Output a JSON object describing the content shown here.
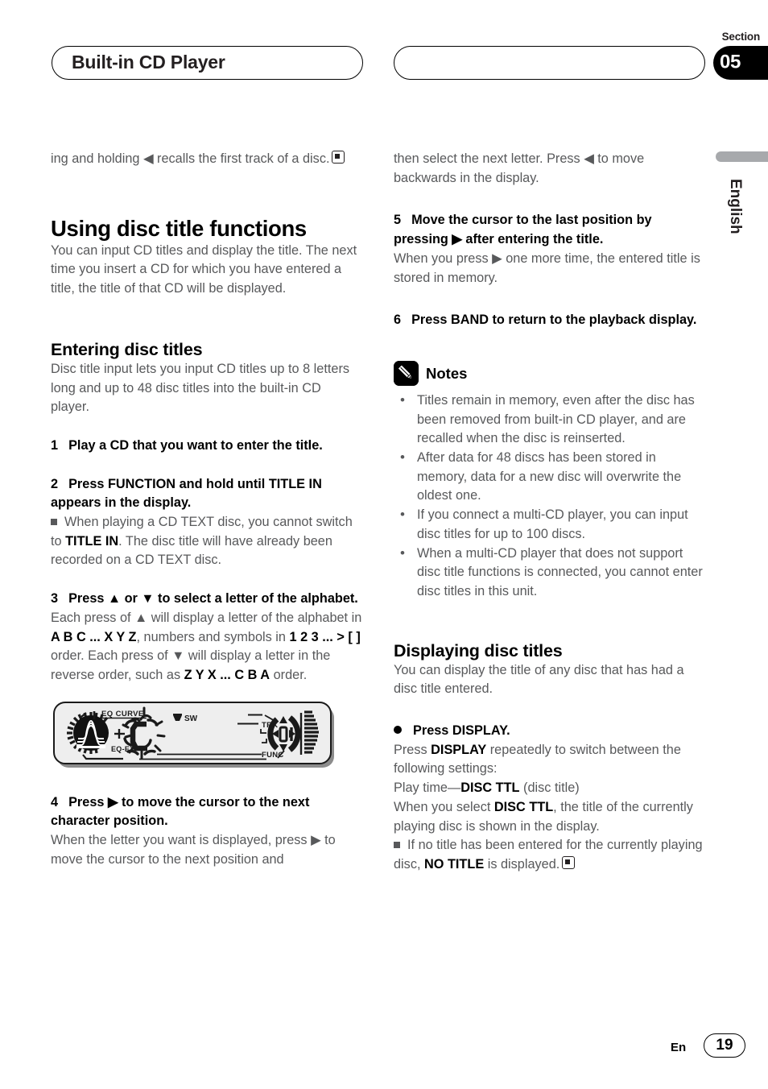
{
  "header": {
    "title": "Built-in CD Player",
    "section_label": "Section",
    "section_number": "05",
    "right_pill_text": ""
  },
  "side_tab": {
    "language": "English"
  },
  "footer": {
    "lang_code": "En",
    "page_number": "19"
  },
  "colors": {
    "body_text": "#58595b",
    "heading": "#000000",
    "tab_gray": "#a7a9ac",
    "badge_black": "#000000"
  },
  "left_column": {
    "continued_paragraph": {
      "part1": "ing and holding ",
      "arrow": "◀",
      "part2": " recalls the first track of a disc.",
      "end_marker": "end-of-section-marker"
    },
    "heading": "Using disc title functions",
    "intro": "You can input CD titles and display the title. The next time you insert a CD for which you have entered a title, the title of that CD will be displayed.",
    "subheading": "Entering disc titles",
    "sub_intro": "Disc title input lets you input CD titles up to 8 letters long and up to 48 disc titles into the built-in CD player.",
    "steps": [
      {
        "num": "1",
        "text": "Play a CD that you want to enter the title."
      },
      {
        "num": "2",
        "text": "Press FUNCTION and hold until TITLE IN appears in the display."
      },
      {
        "num": "3",
        "text": "Press ▲ or ▼ to select a letter of the alphabet."
      },
      {
        "num": "4",
        "text": "Press ▶ to move the cursor to the next character position."
      }
    ],
    "note_after_step2": {
      "a": "When playing a CD TEXT disc, you cannot switch to ",
      "b": "TITLE IN",
      "c": ". The disc title will have already been recorded on a CD TEXT disc."
    },
    "step3_body": {
      "a": "Each press of ▲ will display a letter of the alphabet in ",
      "b": "A B C ... X Y Z",
      "c": ", numbers and symbols in ",
      "d": "1 2 3 ... > [ ]",
      "e": " order. Each press of ▼ will display a letter in the reverse order, such as ",
      "f": "Z Y X ... C B A",
      "g": " order."
    },
    "step4_body": "When the letter you want is displayed, press ▶ to move the cursor to the next position and",
    "display_figure": {
      "name": "car-stereo-lcd-display",
      "labels": [
        "EQ CURVE",
        "EQ-EX",
        "SW",
        "TRK",
        "FUNC"
      ],
      "digit": "01",
      "character": "C"
    }
  },
  "right_column": {
    "continued_paragraph": "then select the next letter. Press ◀ to move backwards in the display.",
    "steps": [
      {
        "num": "5",
        "text": "Move the cursor to the last position by pressing ▶ after entering the title."
      },
      {
        "num": "6",
        "text": "Press BAND to return to the playback display."
      }
    ],
    "step5_body": "When you press ▶ one more time, the entered title is stored in memory.",
    "notes": {
      "title": "Notes",
      "items": [
        "Titles remain in memory, even after the disc has been removed from built-in CD player, and are recalled when the disc is reinserted.",
        "After data for 48 discs has been stored in memory, data for a new disc will overwrite the oldest one.",
        "If you connect a multi-CD player, you can input disc titles for up to 100 discs.",
        "When a multi-CD player that does not support disc title functions is connected, you cannot enter disc titles in this unit."
      ]
    },
    "subheading": "Displaying disc titles",
    "sub_intro": "You can display the title of any disc that has had a disc title entered.",
    "bullet_step": "Press DISPLAY.",
    "display_body": {
      "a": "Press ",
      "b": "DISPLAY",
      "c": " repeatedly to switch between the following settings:"
    },
    "settings_line": {
      "a": "Play time—",
      "b": "DISC TTL",
      "c": " (disc title)"
    },
    "select_line": {
      "a": "When you select ",
      "b": "DISC TTL",
      "c": ", the title of the currently playing disc is shown in the display."
    },
    "final_note": {
      "a": "If no title has been entered for the currently playing disc, ",
      "b": "NO TITLE",
      "c": " is displayed."
    }
  }
}
